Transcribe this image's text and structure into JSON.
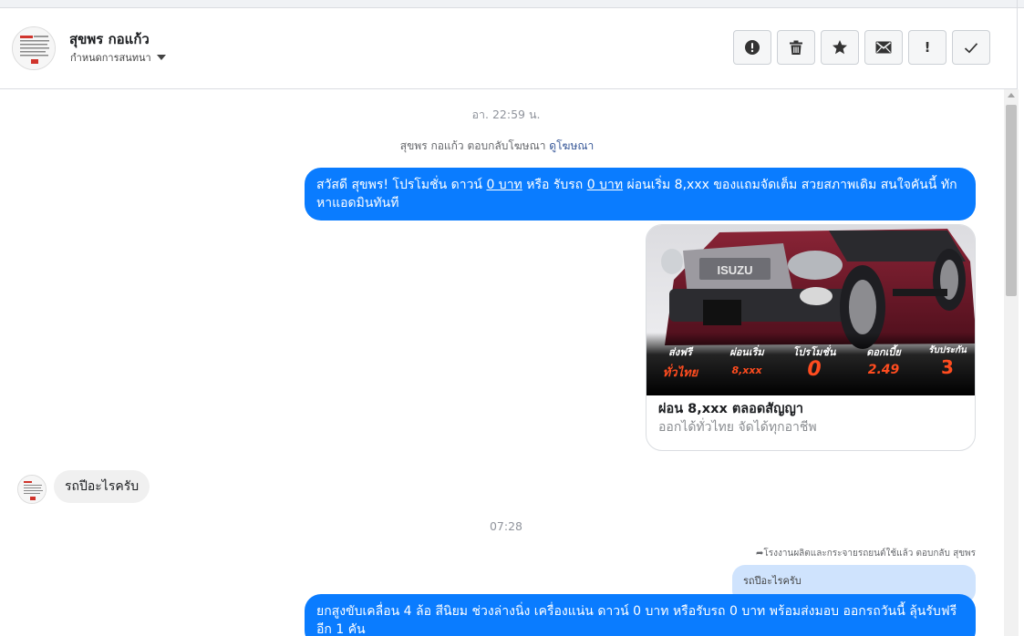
{
  "header": {
    "contact_name": "สุขพร กอแก้ว",
    "assign_label": "กำหนดการสนทนา",
    "actions": [
      {
        "name": "spam-button",
        "icon": "alert-circle-icon"
      },
      {
        "name": "delete-button",
        "icon": "trash-icon"
      },
      {
        "name": "star-button",
        "icon": "star-icon"
      },
      {
        "name": "mark-unread-button",
        "icon": "envelope-icon"
      },
      {
        "name": "follow-up-button",
        "label": "!"
      },
      {
        "name": "mark-done-button",
        "icon": "check-icon"
      }
    ]
  },
  "thread": {
    "timestamp1": "อา. 22:59 น.",
    "ad_reply_text": "สุขพร กอแก้ว ตอบกลับโฆษณา",
    "ad_link": "ดูโฆษณา",
    "message1": {
      "pre": "สวัสดี สุขพร! โปรโมชั่น ดาวน์ ",
      "u1": "0 บาท",
      "mid": " หรือ รับรถ ",
      "u2": "0 บาท",
      "post": " ผ่อนเริ่ม 8,xxx ของแถมจัดเต็ม สวยสภาพเดิม สนใจคันนี้ ทักหาแอดมินทันที"
    },
    "card": {
      "title": "ผ่อน 8,xxx ตลอดสัญญา",
      "subtitle": "ออกได้ทั่วไทย จัดได้ทุกอาชีพ",
      "brand": "ISUZU",
      "promo": [
        {
          "top": "ส่งฟรี",
          "bottom": "ทั่วไทย"
        },
        {
          "top": "ผ่อนเริ่ม",
          "bottom": "8,xxx"
        },
        {
          "top": "โปรโมชั่น",
          "bottom": "0"
        },
        {
          "top": "ดอกเบี้ย",
          "bottom": "2.49"
        },
        {
          "top": "รับประกัน",
          "bottom": "3"
        }
      ]
    },
    "incoming1": "รถปีอะไรครับ",
    "timestamp2": "07:28",
    "reply_note": "โรงงานผลิตและกระจายรถยนต์ใช้แล้ว ตอบกลับ สุขพร",
    "quoted_text": "รถปีอะไรครับ",
    "message2": "ยกสูงขับเคลื่อน 4 ล้อ สีนิยม ช่วงล่างนิ่ง เครื่องแน่น ดาวน์ 0 บาท หรือรับรถ 0 บาท  พร้อมส่งมอบ ออกรถวันนี้ ลุ้นรับฟรีอีก 1 คัน"
  },
  "colors": {
    "outgoing_bubble": "#0a7cff",
    "incoming_bubble": "#f0f0f0",
    "quoted_bubble": "#cfe3fd",
    "link": "#385898"
  }
}
